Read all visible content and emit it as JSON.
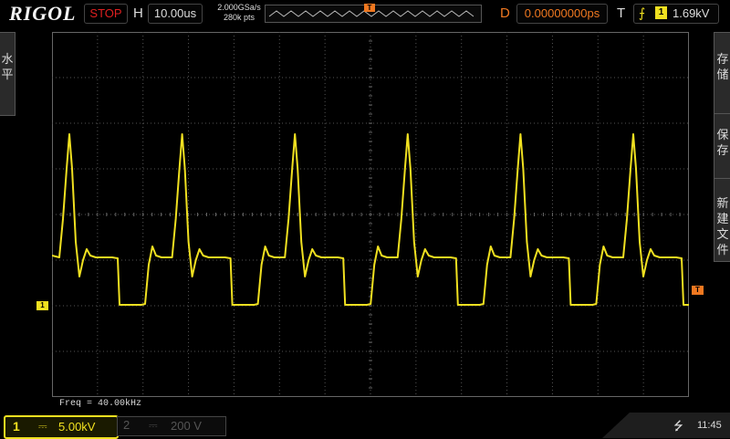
{
  "header": {
    "brand": "RIGOL",
    "run_state": "STOP",
    "horizontal_label": "H",
    "timebase": "10.00us",
    "sample_rate": "2.000GSa/s",
    "memory_depth": "280k pts",
    "delay_label": "D",
    "delay": "0.00000000ps",
    "trigger_label": "T",
    "trigger_source": "1",
    "trigger_level": "1.69kV",
    "trigger_position_marker": "T"
  },
  "left_menu": {
    "label_line1": "水",
    "label_line2": "平"
  },
  "right_menu": {
    "items": [
      {
        "line1": "存",
        "line2": "储"
      },
      {
        "line1": "保",
        "line2": "存"
      },
      {
        "line1": "新",
        "line2": "建",
        "line3": "文",
        "line4": "件"
      }
    ]
  },
  "display": {
    "ch1_marker": "1",
    "trigger_marker": "T",
    "measurement": "Freq = 40.00kHz",
    "trace_color": "#f0e020",
    "trigger_color": "#f07820",
    "grid_color": "#555555"
  },
  "footer": {
    "ch1": {
      "number": "1",
      "coupling": "⎓",
      "scale": "5.00kV"
    },
    "ch2": {
      "number": "2",
      "coupling": "⎓",
      "scale": "200 V"
    },
    "usb_icon": "⭍",
    "time": "11:45"
  }
}
